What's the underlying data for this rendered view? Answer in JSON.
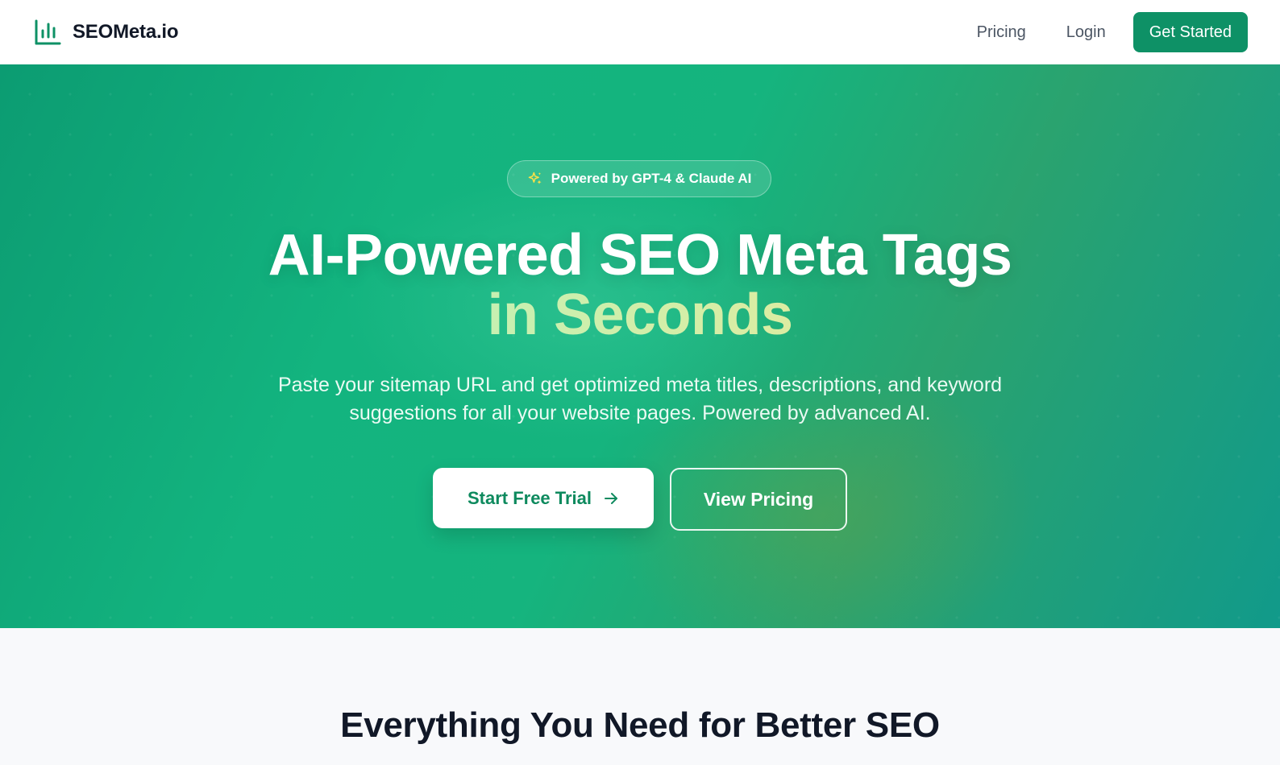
{
  "nav": {
    "brand": "SEOMeta.io",
    "logo_icon": "bar-chart-icon",
    "links": [
      "Pricing",
      "Login"
    ],
    "cta": "Get Started"
  },
  "hero": {
    "badge_icon": "sparkles-icon",
    "badge": "Powered by GPT-4 & Claude AI",
    "title_line1": "AI-Powered SEO Meta Tags",
    "title_line2": "in Seconds",
    "subtitle": "Paste your sitemap URL and get optimized meta titles, descriptions, and keyword suggestions for all your website pages. Powered by advanced AI.",
    "primary_cta": "Start Free Trial",
    "primary_cta_icon": "arrow-right-icon",
    "secondary_cta": "View Pricing"
  },
  "features": {
    "title": "Everything You Need for Better SEO"
  },
  "colors": {
    "brand": "#0e9166",
    "hero_start": "#0c9c72",
    "hero_end": "#119a8a",
    "accent_gradient_start": "#a7f3d0",
    "accent_gradient_end": "#fde68a"
  }
}
